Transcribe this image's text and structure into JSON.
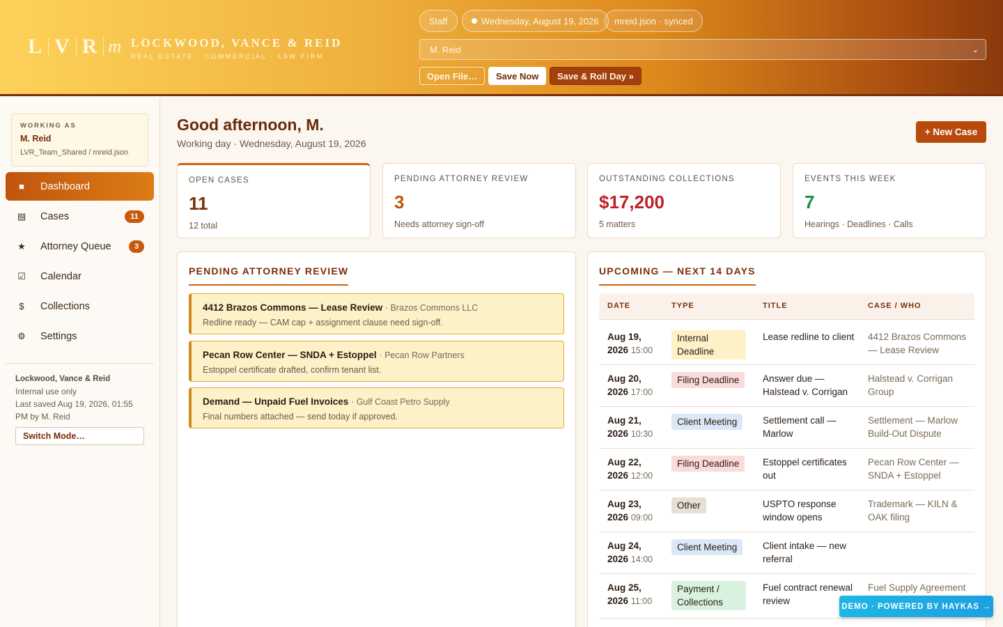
{
  "header": {
    "logo": {
      "l1": "L",
      "l2": "V",
      "l3": "R",
      "l4": "m"
    },
    "firm_name": "LOCKWOOD, VANCE & REID",
    "firm_sub": "REAL ESTATE · COMMERCIAL · LAW FIRM",
    "role_pill": "Staff",
    "date_pill": "Wednesday, August 19, 2026",
    "file_pill": "mreid.json · synced",
    "user_select": "M. Reid",
    "open_file": "Open File…",
    "save_now": "Save Now",
    "save_roll": "Save & Roll Day »"
  },
  "sidebar": {
    "working_label": "WORKING AS",
    "working_name": "M. Reid",
    "working_file": "LVR_Team_Shared / mreid.json",
    "items": [
      {
        "label": "Dashboard",
        "icon": "square-icon",
        "glyph": "■"
      },
      {
        "label": "Cases",
        "icon": "list-icon",
        "glyph": "▤",
        "badge": "11"
      },
      {
        "label": "Attorney Queue",
        "icon": "star-icon",
        "glyph": "★",
        "badge": "3"
      },
      {
        "label": "Calendar",
        "icon": "checkbox-icon",
        "glyph": "☑"
      },
      {
        "label": "Collections",
        "icon": "dollar-icon",
        "glyph": "$"
      },
      {
        "label": "Settings",
        "icon": "gear-icon",
        "glyph": "⚙"
      }
    ],
    "footer_firm": "Lockwood, Vance & Reid",
    "footer_note": "Internal use only",
    "footer_saved": "Last saved Aug 19, 2026, 01:55 PM by M. Reid",
    "switch_mode": "Switch Mode…"
  },
  "main": {
    "greeting": "Good afternoon, M.",
    "subtitle": "Working day · Wednesday, August 19, 2026",
    "new_case": "+ New Case",
    "stats": [
      {
        "label": "OPEN CASES",
        "value": "11",
        "sub": "12 total",
        "color": "#7a2d0b"
      },
      {
        "label": "PENDING ATTORNEY REVIEW",
        "value": "3",
        "sub": "Needs attorney sign-off",
        "color": "#c2560e"
      },
      {
        "label": "OUTSTANDING COLLECTIONS",
        "value": "$17,200",
        "sub": "5 matters",
        "color": "#c0202a"
      },
      {
        "label": "EVENTS THIS WEEK",
        "value": "7",
        "sub": "Hearings · Deadlines · Calls",
        "color": "#1f8a46"
      }
    ],
    "review_title": "PENDING ATTORNEY REVIEW",
    "reviews": [
      {
        "title": "4412 Brazos Commons — Lease Review",
        "client": "· Brazos Commons LLC",
        "note": "Redline ready — CAM cap + assignment clause need sign-off."
      },
      {
        "title": "Pecan Row Center — SNDA + Estoppel",
        "client": "· Pecan Row Partners",
        "note": "Estoppel certificate drafted, confirm tenant list."
      },
      {
        "title": "Demand — Unpaid Fuel Invoices",
        "client": "· Gulf Coast Petro Supply",
        "note": "Final numbers attached — send today if approved."
      }
    ],
    "upcoming_title": "UPCOMING — NEXT 14 DAYS",
    "columns": [
      "DATE",
      "TYPE",
      "TITLE",
      "CASE / WHO"
    ],
    "events": [
      {
        "date": "Aug 19,",
        "year": "2026",
        "time": "15:00",
        "type": "Internal Deadline",
        "type_class": "internal",
        "title": "Lease redline to client",
        "case": "4412 Brazos Commons — Lease Review"
      },
      {
        "date": "Aug 20,",
        "year": "2026",
        "time": "17:00",
        "type": "Filing Deadline",
        "type_class": "filing",
        "title": "Answer due — Halstead v. Corrigan",
        "case": "Halstead v. Corrigan Group"
      },
      {
        "date": "Aug 21,",
        "year": "2026",
        "time": "10:30",
        "type": "Client Meeting",
        "type_class": "meeting",
        "title": "Settlement call — Marlow",
        "case": "Settlement — Marlow Build-Out Dispute"
      },
      {
        "date": "Aug 22,",
        "year": "2026",
        "time": "12:00",
        "type": "Filing Deadline",
        "type_class": "filing",
        "title": "Estoppel certificates out",
        "case": "Pecan Row Center — SNDA + Estoppel"
      },
      {
        "date": "Aug 23,",
        "year": "2026",
        "time": "09:00",
        "type": "Other",
        "type_class": "other",
        "title": "USPTO response window opens",
        "case": "Trademark — KILN & OAK filing"
      },
      {
        "date": "Aug 24,",
        "year": "2026",
        "time": "14:00",
        "type": "Client Meeting",
        "type_class": "meeting",
        "title": "Client intake — new referral",
        "case": ""
      },
      {
        "date": "Aug 25,",
        "year": "2026",
        "time": "11:00",
        "type": "Payment / Collections",
        "type_class": "payment",
        "title": "Fuel contract renewal review",
        "case": "Fuel Supply Agreement"
      }
    ]
  },
  "demo_badge": "DEMO · POWERED BY HAYKAS →"
}
